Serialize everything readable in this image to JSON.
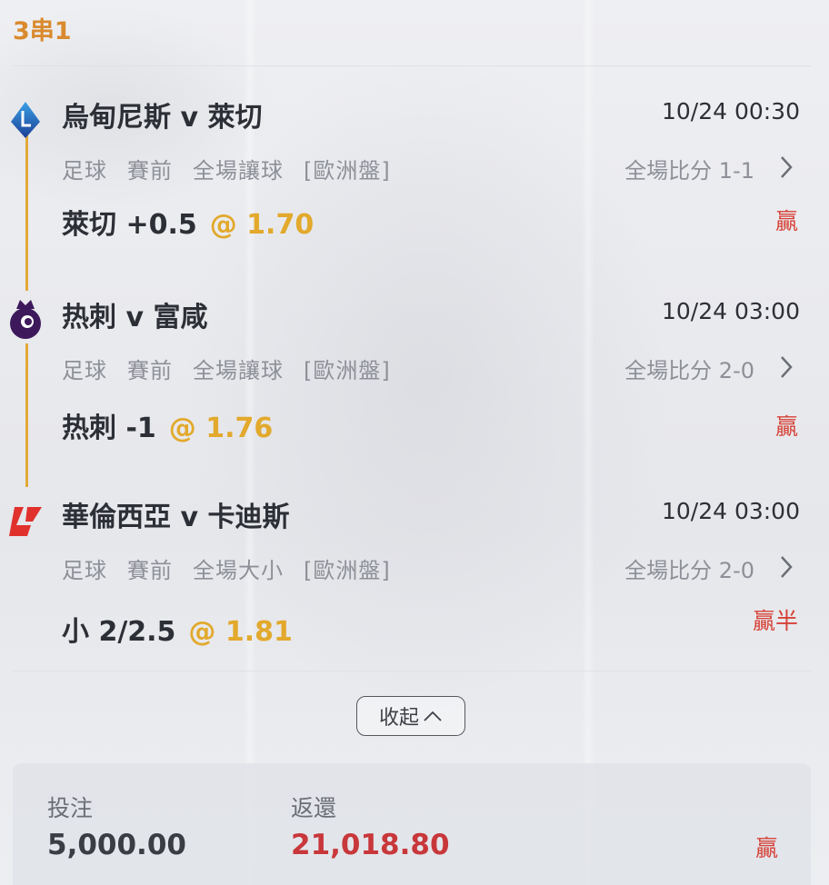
{
  "header": {
    "title": "3串1"
  },
  "bets": [
    {
      "match": "烏甸尼斯 v 萊切",
      "time": "10/24 00:30",
      "sport": "足球",
      "stage": "賽前",
      "market": "全場讓球",
      "odds_type": "[歐洲盤]",
      "score": "全場比分 1-1",
      "pick": "萊切 +0.5",
      "odds": "@ 1.70",
      "result": "贏",
      "league_icon": "serie-a-icon"
    },
    {
      "match": "热刺 v 富咸",
      "time": "10/24 03:00",
      "sport": "足球",
      "stage": "賽前",
      "market": "全場讓球",
      "odds_type": "[歐洲盤]",
      "score": "全場比分 2-0",
      "pick": "热刺 -1",
      "odds": "@ 1.76",
      "result": "贏",
      "league_icon": "premier-league-icon"
    },
    {
      "match": "華倫西亞 v 卡迪斯",
      "time": "10/24 03:00",
      "sport": "足球",
      "stage": "賽前",
      "market": "全場大小",
      "odds_type": "[歐洲盤]",
      "score": "全場比分 2-0",
      "pick": "小 2/2.5",
      "odds": "@ 1.81",
      "result": "贏半",
      "league_icon": "laliga-icon"
    }
  ],
  "collapse_label": "收起",
  "summary": {
    "stake_label": "投注",
    "stake_value": "5,000.00",
    "return_label": "返還",
    "return_value": "21,018.80",
    "result": "贏"
  },
  "colors": {
    "accent": "#d98a2e",
    "odds": "#e2a92c",
    "win": "#d64238",
    "timeline": "#e4a93a"
  }
}
